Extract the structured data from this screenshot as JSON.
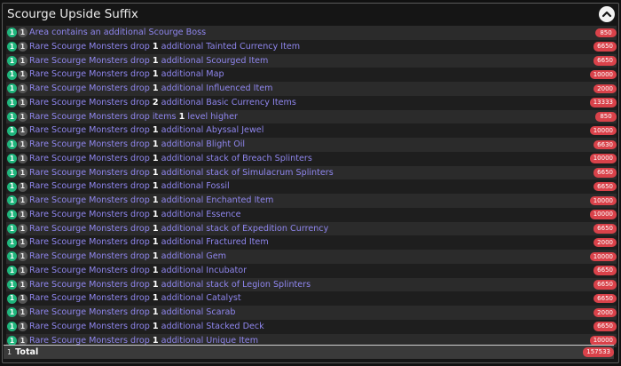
{
  "panel": {
    "title": "Scourge Upside Suffix",
    "collapse_icon": "chevron-up-icon"
  },
  "rows": [
    {
      "tier": "1",
      "count": "1",
      "before": "Area contains an additional Scourge Boss",
      "num": "",
      "after": "",
      "value": "850"
    },
    {
      "tier": "1",
      "count": "1",
      "before": "Rare Scourge Monsters drop ",
      "num": "1",
      "after": " additional Tainted Currency Item",
      "value": "6650"
    },
    {
      "tier": "1",
      "count": "1",
      "before": "Rare Scourge Monsters drop ",
      "num": "1",
      "after": " additional Scourged Item",
      "value": "6650"
    },
    {
      "tier": "1",
      "count": "1",
      "before": "Rare Scourge Monsters drop ",
      "num": "1",
      "after": " additional Map",
      "value": "10000"
    },
    {
      "tier": "1",
      "count": "1",
      "before": "Rare Scourge Monsters drop ",
      "num": "1",
      "after": " additional Influenced Item",
      "value": "2000"
    },
    {
      "tier": "1",
      "count": "1",
      "before": "Rare Scourge Monsters drop ",
      "num": "2",
      "after": " additional Basic Currency Items",
      "value": "13333"
    },
    {
      "tier": "1",
      "count": "1",
      "before": "Rare Scourge Monsters drop items ",
      "num": "1",
      "after": " level higher",
      "value": "850"
    },
    {
      "tier": "1",
      "count": "1",
      "before": "Rare Scourge Monsters drop ",
      "num": "1",
      "after": " additional Abyssal Jewel",
      "value": "10000"
    },
    {
      "tier": "1",
      "count": "1",
      "before": "Rare Scourge Monsters drop ",
      "num": "1",
      "after": " additional Blight Oil",
      "value": "6630"
    },
    {
      "tier": "1",
      "count": "1",
      "before": "Rare Scourge Monsters drop ",
      "num": "1",
      "after": " additional stack of Breach Splinters",
      "value": "10000"
    },
    {
      "tier": "1",
      "count": "1",
      "before": "Rare Scourge Monsters drop ",
      "num": "1",
      "after": " additional stack of Simulacrum Splinters",
      "value": "6650"
    },
    {
      "tier": "1",
      "count": "1",
      "before": "Rare Scourge Monsters drop ",
      "num": "1",
      "after": " additional Fossil",
      "value": "6650"
    },
    {
      "tier": "1",
      "count": "1",
      "before": "Rare Scourge Monsters drop ",
      "num": "1",
      "after": " additional Enchanted Item",
      "value": "10000"
    },
    {
      "tier": "1",
      "count": "1",
      "before": "Rare Scourge Monsters drop ",
      "num": "1",
      "after": " additional Essence",
      "value": "10000"
    },
    {
      "tier": "1",
      "count": "1",
      "before": "Rare Scourge Monsters drop ",
      "num": "1",
      "after": " additional stack of Expedition Currency",
      "value": "6650"
    },
    {
      "tier": "1",
      "count": "1",
      "before": "Rare Scourge Monsters drop ",
      "num": "1",
      "after": " additional Fractured Item",
      "value": "2000"
    },
    {
      "tier": "1",
      "count": "1",
      "before": "Rare Scourge Monsters drop ",
      "num": "1",
      "after": " additional Gem",
      "value": "10000"
    },
    {
      "tier": "1",
      "count": "1",
      "before": "Rare Scourge Monsters drop ",
      "num": "1",
      "after": " additional Incubator",
      "value": "6650"
    },
    {
      "tier": "1",
      "count": "1",
      "before": "Rare Scourge Monsters drop ",
      "num": "1",
      "after": " additional stack of Legion Splinters",
      "value": "6650"
    },
    {
      "tier": "1",
      "count": "1",
      "before": "Rare Scourge Monsters drop ",
      "num": "1",
      "after": " additional Catalyst",
      "value": "6650"
    },
    {
      "tier": "1",
      "count": "1",
      "before": "Rare Scourge Monsters drop ",
      "num": "1",
      "after": " additional Scarab",
      "value": "2000"
    },
    {
      "tier": "1",
      "count": "1",
      "before": "Rare Scourge Monsters drop ",
      "num": "1",
      "after": " additional Stacked Deck",
      "value": "6650"
    },
    {
      "tier": "1",
      "count": "1",
      "before": "Rare Scourge Monsters drop ",
      "num": "1",
      "after": " additional Unique Item",
      "value": "10000"
    }
  ],
  "total": {
    "count": "1",
    "label": "Total",
    "value": "157533"
  },
  "colors": {
    "mod_text": "#8f86ee",
    "tier_badge": "#1fb57c",
    "value_pill": "#d9424a"
  }
}
